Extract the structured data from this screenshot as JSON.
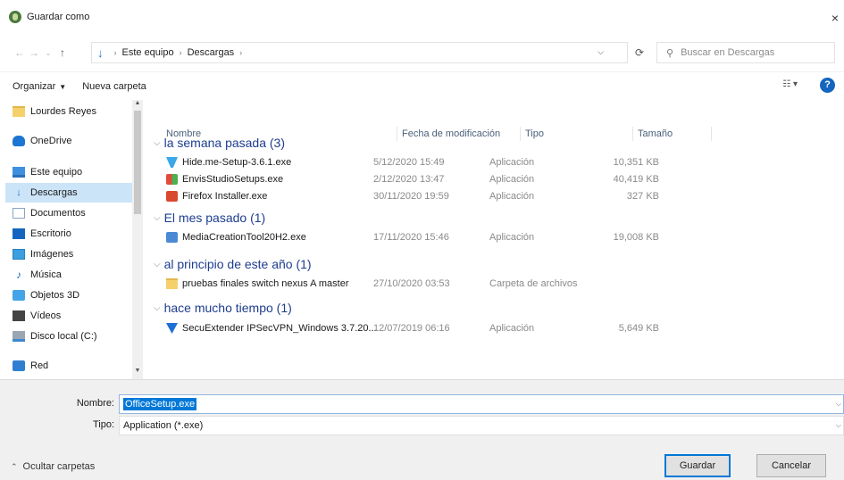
{
  "window": {
    "title": "Guardar como",
    "close_glyph": "×"
  },
  "address": {
    "crumbs": [
      "Este equipo",
      "Descargas"
    ],
    "search_placeholder": "Buscar en Descargas"
  },
  "toolbar": {
    "organize_label": "Organizar",
    "new_folder_label": "Nueva carpeta"
  },
  "sidebar": {
    "items": [
      {
        "label": "Lourdes Reyes",
        "icon": "folder-icon"
      },
      {
        "label": "OneDrive",
        "icon": "cloud-icon"
      },
      {
        "label": "Este equipo",
        "icon": "computer-icon"
      },
      {
        "label": "Descargas",
        "icon": "download-icon",
        "selected": true
      },
      {
        "label": "Documentos",
        "icon": "document-icon"
      },
      {
        "label": "Escritorio",
        "icon": "desktop-icon"
      },
      {
        "label": "Imágenes",
        "icon": "pictures-icon"
      },
      {
        "label": "Música",
        "icon": "music-icon"
      },
      {
        "label": "Objetos 3D",
        "icon": "objects-3d-icon"
      },
      {
        "label": "Vídeos",
        "icon": "videos-icon"
      },
      {
        "label": "Disco local (C:)",
        "icon": "disk-icon"
      },
      {
        "label": "Red",
        "icon": "network-icon"
      }
    ]
  },
  "columns": {
    "name": "Nombre",
    "date": "Fecha de modificación",
    "type": "Tipo",
    "size": "Tamaño"
  },
  "groups": [
    {
      "label": "la semana pasada (3)",
      "files": [
        {
          "name": "Hide.me-Setup-3.6.1.exe",
          "date": "5/12/2020 15:49",
          "type": "Aplicación",
          "size": "10,351 KB",
          "icon": "hideme-app-icon"
        },
        {
          "name": "EnvisStudioSetups.exe",
          "date": "2/12/2020 13:47",
          "type": "Aplicación",
          "size": "40,419 KB",
          "icon": "envis-app-icon"
        },
        {
          "name": "Firefox Installer.exe",
          "date": "30/11/2020 19:59",
          "type": "Aplicación",
          "size": "327 KB",
          "icon": "firefox-app-icon"
        }
      ]
    },
    {
      "label": "El mes pasado (1)",
      "files": [
        {
          "name": "MediaCreationTool20H2.exe",
          "date": "17/11/2020 15:46",
          "type": "Aplicación",
          "size": "19,008 KB",
          "icon": "media-creation-app-icon"
        }
      ]
    },
    {
      "label": "al principio de este año (1)",
      "files": [
        {
          "name": "pruebas finales switch nexus A master",
          "date": "27/10/2020 03:53",
          "type": "Carpeta de archivos",
          "size": "",
          "icon": "folder-icon"
        }
      ]
    },
    {
      "label": "hace mucho tiempo (1)",
      "files": [
        {
          "name": "SecuExtender IPSecVPN_Windows 3.7.20...",
          "date": "12/07/2019 06:16",
          "type": "Aplicación",
          "size": "5,649 KB",
          "icon": "vpn-app-icon"
        }
      ]
    }
  ],
  "form": {
    "name_label": "Nombre:",
    "name_value": "OfficeSetup.exe",
    "type_label": "Tipo:",
    "type_value": "Application (*.exe)"
  },
  "footer": {
    "hide_folders_label": "Ocultar carpetas",
    "save_label": "Guardar",
    "cancel_label": "Cancelar"
  }
}
